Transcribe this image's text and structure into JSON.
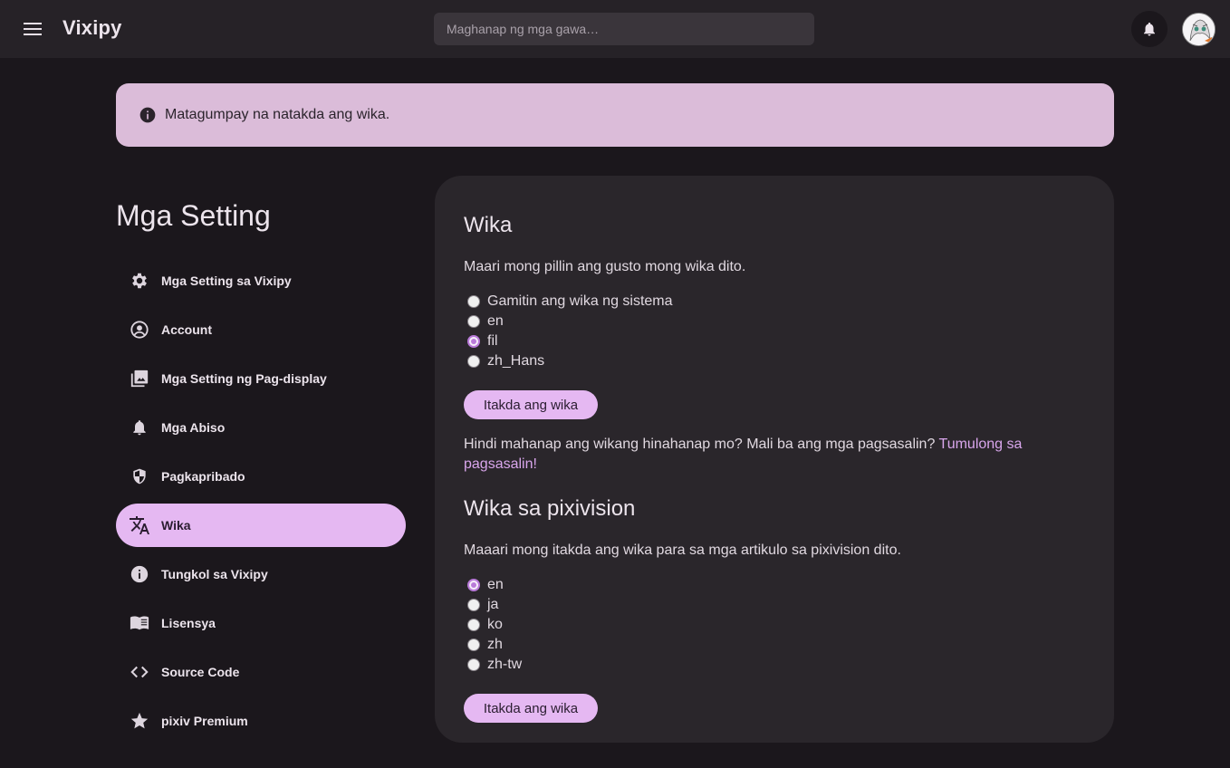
{
  "app": {
    "title": "Vixipy"
  },
  "search": {
    "placeholder": "Maghanap ng mga gawa…"
  },
  "banner": {
    "message": "Matagumpay na natakda ang wika."
  },
  "sidebar": {
    "title": "Mga Setting",
    "items": [
      {
        "label": "Mga Setting sa Vixipy",
        "icon": "gear-icon"
      },
      {
        "label": "Account",
        "icon": "account-circle-icon"
      },
      {
        "label": "Mga Setting ng Pag-display",
        "icon": "photo-library-icon"
      },
      {
        "label": "Mga Abiso",
        "icon": "bell-icon"
      },
      {
        "label": "Pagkapribado",
        "icon": "shield-icon"
      },
      {
        "label": "Wika",
        "icon": "translate-icon",
        "active": true
      },
      {
        "label": "Tungkol sa Vixipy",
        "icon": "info-icon"
      },
      {
        "label": "Lisensya",
        "icon": "book-icon"
      },
      {
        "label": "Source Code",
        "icon": "code-icon"
      },
      {
        "label": "pixiv Premium",
        "icon": "star-icon"
      }
    ]
  },
  "language": {
    "title": "Wika",
    "description": "Maari mong pillin ang gusto mong wika dito.",
    "options": [
      "Gamitin ang wika ng sistema",
      "en",
      "fil",
      "zh_Hans"
    ],
    "selected": "fil",
    "button": "Itakda ang wika",
    "help_text": "Hindi mahanap ang wikang hinahanap mo? Mali ba ang mga pagsasalin? ",
    "help_link": "Tumulong sa pagsasalin",
    "help_end": "!"
  },
  "pixivision": {
    "title": "Wika sa pixivision",
    "description": "Maaari mong itakda ang wika para sa mga artikulo sa pixivision dito.",
    "options": [
      "en",
      "ja",
      "ko",
      "zh",
      "zh-tw"
    ],
    "selected": "en",
    "button": "Itakda ang wika"
  },
  "colors": {
    "accent": "#e5b8f2",
    "background": "#1b171c",
    "card": "#2a262b",
    "banner": "#dbbcd9"
  }
}
